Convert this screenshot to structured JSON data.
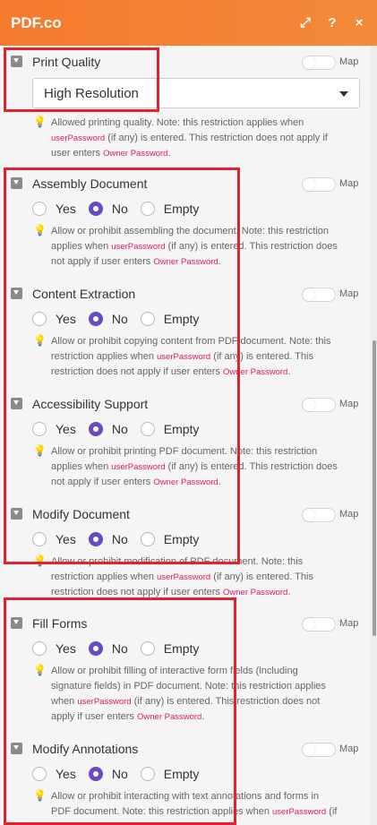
{
  "header": {
    "title": "PDF.co",
    "icons": [
      "expand-icon",
      "help-icon",
      "close-icon"
    ]
  },
  "map_label": "Map",
  "print_quality": {
    "label": "Print Quality",
    "selected": "High Resolution",
    "note_1": "Allowed printing quality. Note: this restriction applies when",
    "code_1": "userPassword",
    "note_2": "(if any) is entered. This restriction does not apply if",
    "note_3": "user enters",
    "code_2": "Owner Password",
    "note_4": "."
  },
  "options": {
    "yes": "Yes",
    "no": "No",
    "empty": "Empty"
  },
  "fields": [
    {
      "label": "Assembly Document",
      "selected": "No",
      "lines": [
        [
          "Allow or prohibit assembling the document. Note: this restriction",
          "",
          ""
        ],
        [
          "applies when",
          "userPassword",
          "(if any) is entered. This restriction does"
        ],
        [
          "not apply if user enters",
          "Owner Password",
          "."
        ]
      ]
    },
    {
      "label": "Content Extraction",
      "selected": "No",
      "lines": [
        [
          "Allow or prohibit copying content from PDF document. Note: this",
          "",
          ""
        ],
        [
          "restriction applies when",
          "userPassword",
          "(if any) is entered. This"
        ],
        [
          "restriction does not apply if user enters",
          "Owner Password",
          "."
        ]
      ]
    },
    {
      "label": "Accessibility Support",
      "selected": "No",
      "lines": [
        [
          "Allow or prohibit printing PDF document. Note: this restriction",
          "",
          ""
        ],
        [
          "applies when",
          "userPassword",
          "(if any) is entered. This restriction does"
        ],
        [
          "not apply if user enters",
          "Owner Password",
          "."
        ]
      ]
    },
    {
      "label": "Modify Document",
      "selected": "No",
      "lines": [
        [
          "Allow or prohibit modification of PDF document. Note: this",
          "",
          ""
        ],
        [
          "restriction applies when",
          "userPassword",
          "(if any) is entered. This"
        ],
        [
          "restriction does not apply if user enters",
          "Owner Password",
          "."
        ]
      ]
    },
    {
      "label": "Fill Forms",
      "selected": "No",
      "lines": [
        [
          "Allow or prohibit filling of interactive form fields (including",
          "",
          ""
        ],
        [
          "signature fields) in PDF document. Note: this restriction applies",
          "",
          ""
        ],
        [
          "when",
          "userPassword",
          "(if any) is entered. This restriction does not"
        ],
        [
          "apply if user enters",
          "Owner Password",
          "."
        ]
      ]
    },
    {
      "label": "Modify Annotations",
      "selected": "No",
      "lines": [
        [
          "Allow or prohibit interacting with text annotations and forms in",
          "",
          ""
        ],
        [
          "PDF document. Note: this restriction applies when",
          "userPassword",
          "(if"
        ]
      ]
    }
  ]
}
